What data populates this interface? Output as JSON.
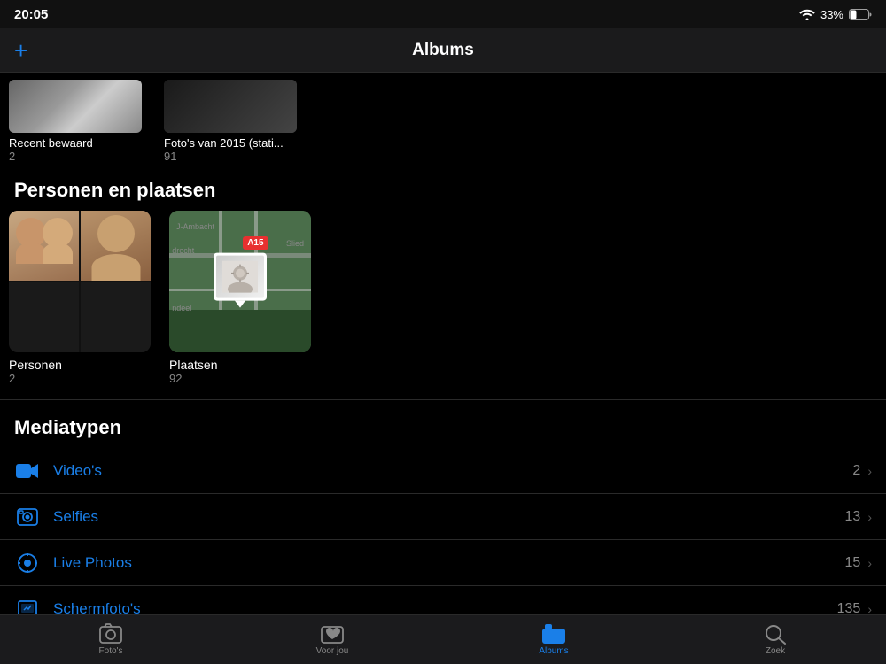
{
  "statusBar": {
    "time": "20:05",
    "battery": "33%",
    "wifiLabel": "wifi"
  },
  "navBar": {
    "title": "Albums",
    "addButton": "+"
  },
  "topAlbums": [
    {
      "label": "Recent bewaard",
      "count": "2"
    },
    {
      "label": "Foto's van 2015 (stati...",
      "count": "91"
    }
  ],
  "sections": {
    "peopleAndPlaces": {
      "header": "Personen en plaatsen",
      "people": {
        "label": "Personen",
        "count": "2"
      },
      "places": {
        "label": "Plaatsen",
        "count": "92"
      }
    },
    "mediaTypes": {
      "header": "Mediatypen",
      "items": [
        {
          "icon": "video",
          "label": "Video's",
          "count": "2"
        },
        {
          "icon": "selfie",
          "label": "Selfies",
          "count": "13"
        },
        {
          "icon": "live",
          "label": "Live Photos",
          "count": "15"
        },
        {
          "icon": "screenshot",
          "label": "Schermfoto's",
          "count": "135"
        }
      ]
    }
  },
  "tabBar": {
    "tabs": [
      {
        "label": "Foto's",
        "icon": "photo",
        "active": false
      },
      {
        "label": "Voor jou",
        "icon": "heart",
        "active": false
      },
      {
        "label": "Albums",
        "icon": "folder",
        "active": true
      },
      {
        "label": "Zoek",
        "icon": "search",
        "active": false
      }
    ]
  },
  "mapBadge": "A15"
}
